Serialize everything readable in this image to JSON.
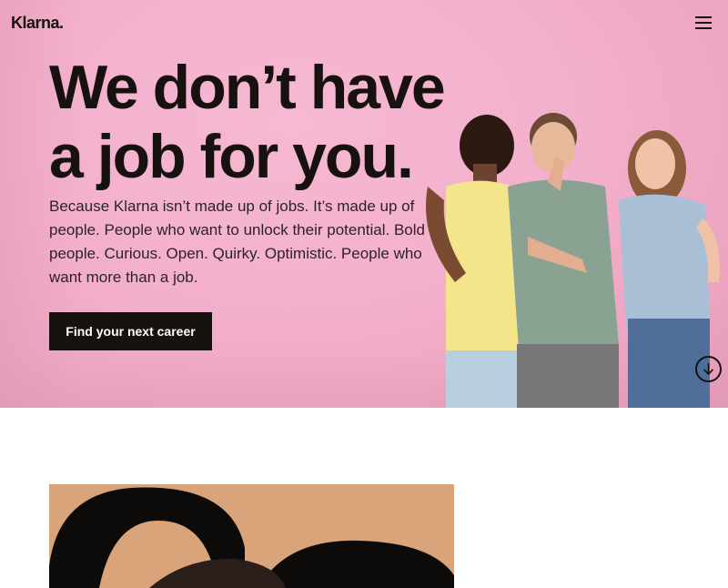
{
  "header": {
    "logo_text": "Klarna.",
    "menu_icon": "hamburger-menu-icon"
  },
  "hero": {
    "headline_line1": "We don’t have",
    "headline_line2": "a job for you.",
    "body": "Because Klarna isn’t made up of jobs. It’s made up of people. People who want to unlock their potential. Bold people. Curious. Open. Quirky. Optimistic. People who want more than a job.",
    "cta_label": "Find your next career",
    "scroll_icon": "arrow-down-circle-icon"
  },
  "colors": {
    "hero_background": "#f3b0cc",
    "text": "#17120f",
    "button_background": "#17120f",
    "button_text": "#ffffff",
    "photo_background": "#d9a47a"
  }
}
